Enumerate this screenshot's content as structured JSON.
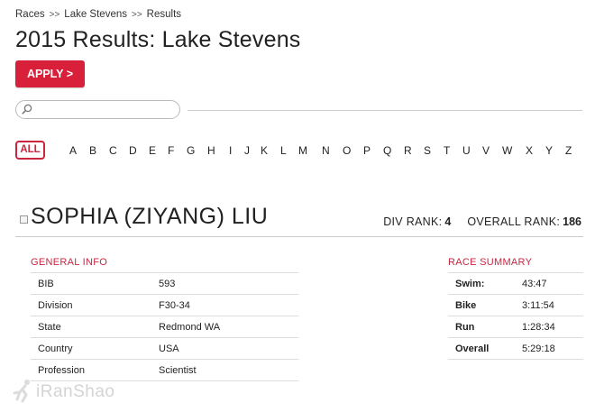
{
  "breadcrumb": {
    "items": [
      "Races",
      "Lake Stevens",
      "Results"
    ],
    "separator": ">>"
  },
  "page": {
    "title": "2015 Results: Lake Stevens"
  },
  "apply_button": {
    "label": "APPLY >"
  },
  "search": {
    "value": "",
    "placeholder": ""
  },
  "filter": {
    "all_label": "ALL",
    "letters": [
      "A",
      "B",
      "C",
      "D",
      "E",
      "F",
      "G",
      "H",
      "I",
      "J",
      "K",
      "L",
      "M",
      "N",
      "O",
      "P",
      "Q",
      "R",
      "S",
      "T",
      "U",
      "V",
      "W",
      "X",
      "Y",
      "Z"
    ]
  },
  "athlete": {
    "name": "SOPHIA (ZIYANG) LIU",
    "div_rank_label": "DIV RANK:",
    "div_rank": "4",
    "overall_rank_label": "OVERALL RANK:",
    "overall_rank": "186"
  },
  "general_info": {
    "title": "GENERAL INFO",
    "rows": [
      {
        "label": "BIB",
        "value": "593"
      },
      {
        "label": "Division",
        "value": "F30-34"
      },
      {
        "label": "State",
        "value": "Redmond WA"
      },
      {
        "label": "Country",
        "value": "USA"
      },
      {
        "label": "Profession",
        "value": "Scientist"
      }
    ]
  },
  "race_summary": {
    "title": "RACE SUMMARY",
    "rows": [
      {
        "label": "Swim:",
        "value": "43:47"
      },
      {
        "label": "Bike",
        "value": "3:11:54"
      },
      {
        "label": "Run",
        "value": "1:28:34"
      },
      {
        "label": "Overall",
        "value": "5:29:18"
      }
    ]
  },
  "watermark": {
    "text": "iRanShao"
  },
  "colors": {
    "accent": "#d8203a",
    "accent_text": "#c9253f",
    "divider": "#cccccc"
  }
}
